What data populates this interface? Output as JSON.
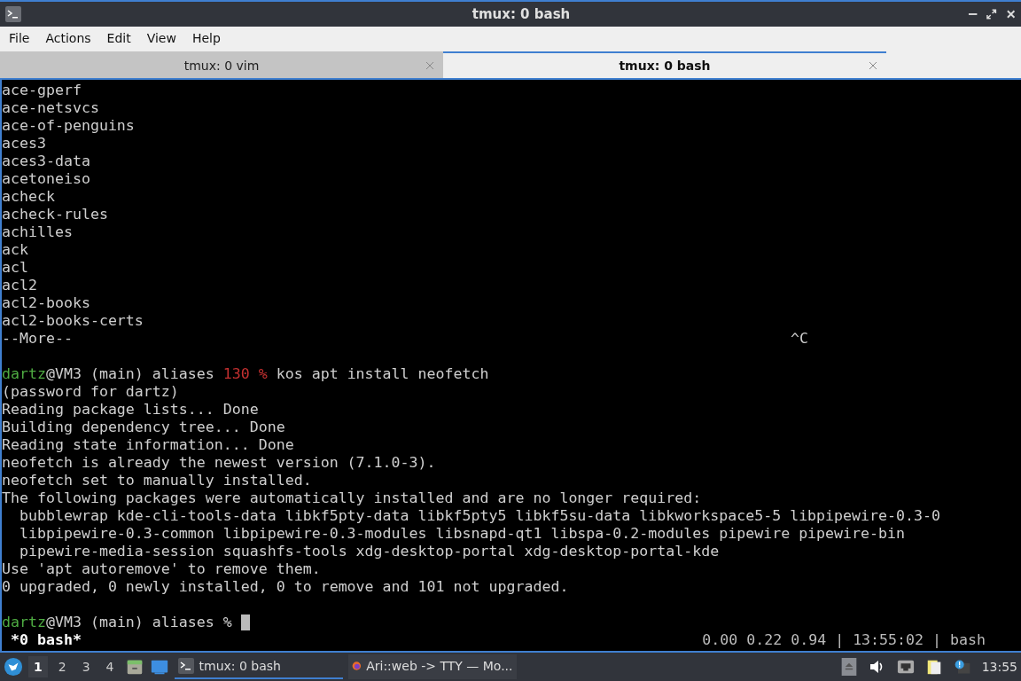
{
  "window": {
    "title": "tmux: 0 bash"
  },
  "menu": [
    "File",
    "Actions",
    "Edit",
    "View",
    "Help"
  ],
  "tabs": [
    {
      "label": "tmux: 0 vim",
      "selected": false
    },
    {
      "label": "tmux: 0 bash",
      "selected": true
    }
  ],
  "terminal": {
    "blocks": [
      {
        "lines": [
          {
            "segments": [
              {
                "text": "ace-gperf"
              }
            ]
          },
          {
            "segments": [
              {
                "text": "ace-netsvcs"
              }
            ]
          },
          {
            "segments": [
              {
                "text": "ace-of-penguins"
              }
            ]
          },
          {
            "segments": [
              {
                "text": "aces3"
              }
            ]
          },
          {
            "segments": [
              {
                "text": "aces3-data"
              }
            ]
          },
          {
            "segments": [
              {
                "text": "acetoneiso"
              }
            ]
          },
          {
            "segments": [
              {
                "text": "acheck"
              }
            ]
          },
          {
            "segments": [
              {
                "text": "acheck-rules"
              }
            ]
          },
          {
            "segments": [
              {
                "text": "achilles"
              }
            ]
          },
          {
            "segments": [
              {
                "text": "ack"
              }
            ]
          },
          {
            "segments": [
              {
                "text": "acl"
              }
            ]
          },
          {
            "segments": [
              {
                "text": "acl2"
              }
            ]
          },
          {
            "segments": [
              {
                "text": "acl2-books"
              }
            ]
          },
          {
            "segments": [
              {
                "text": "acl2-books-certs"
              }
            ]
          },
          {
            "segments": [
              {
                "text": "--More--"
              }
            ],
            "right": "^C"
          }
        ]
      },
      {
        "lines": [
          {
            "segments": [
              {
                "text": "dartz",
                "kind": "user"
              },
              {
                "text": "@VM3 (main) aliases "
              },
              {
                "text": "130 %",
                "kind": "error"
              },
              {
                "text": " kos apt install neofetch"
              }
            ]
          },
          {
            "segments": [
              {
                "text": "(password for dartz)"
              }
            ]
          },
          {
            "segments": [
              {
                "text": "Reading package lists... Done"
              }
            ]
          },
          {
            "segments": [
              {
                "text": "Building dependency tree... Done"
              }
            ]
          },
          {
            "segments": [
              {
                "text": "Reading state information... Done"
              }
            ]
          },
          {
            "segments": [
              {
                "text": "neofetch is already the newest version (7.1.0-3)."
              }
            ]
          },
          {
            "segments": [
              {
                "text": "neofetch set to manually installed."
              }
            ]
          },
          {
            "segments": [
              {
                "text": "The following packages were automatically installed and are no longer required:"
              }
            ]
          },
          {
            "segments": [
              {
                "text": "  bubblewrap kde-cli-tools-data libkf5pty-data libkf5pty5 libkf5su-data libkworkspace5-5 libpipewire-0.3-0"
              }
            ]
          },
          {
            "segments": [
              {
                "text": "  libpipewire-0.3-common libpipewire-0.3-modules libsnapd-qt1 libspa-0.2-modules pipewire pipewire-bin"
              }
            ]
          },
          {
            "segments": [
              {
                "text": "  pipewire-media-session squashfs-tools xdg-desktop-portal xdg-desktop-portal-kde"
              }
            ]
          },
          {
            "segments": [
              {
                "text": "Use 'apt autoremove' to remove them."
              }
            ]
          },
          {
            "segments": [
              {
                "text": "0 upgraded, 0 newly installed, 0 to remove and 101 not upgraded."
              }
            ]
          }
        ]
      },
      {
        "lines": [
          {
            "segments": [
              {
                "text": "dartz",
                "kind": "user"
              },
              {
                "text": "@VM3 (main) aliases % "
              }
            ],
            "cursor": true
          }
        ]
      }
    ],
    "status_left": "*0 bash*",
    "status_right": "0.00 0.22 0.94 | 13:55:02 | bash"
  },
  "taskbar": {
    "workspaces": [
      {
        "label": "1",
        "selected": true
      },
      {
        "label": "2",
        "selected": false
      },
      {
        "label": "3",
        "selected": false
      },
      {
        "label": "4",
        "selected": false
      }
    ],
    "tasks": [
      {
        "label": "tmux: 0 bash",
        "kind": "terminal",
        "selected": true
      },
      {
        "label": "Ari::web -> TTY — Mo...",
        "kind": "browser",
        "selected": false
      }
    ],
    "clock": "13:55"
  }
}
